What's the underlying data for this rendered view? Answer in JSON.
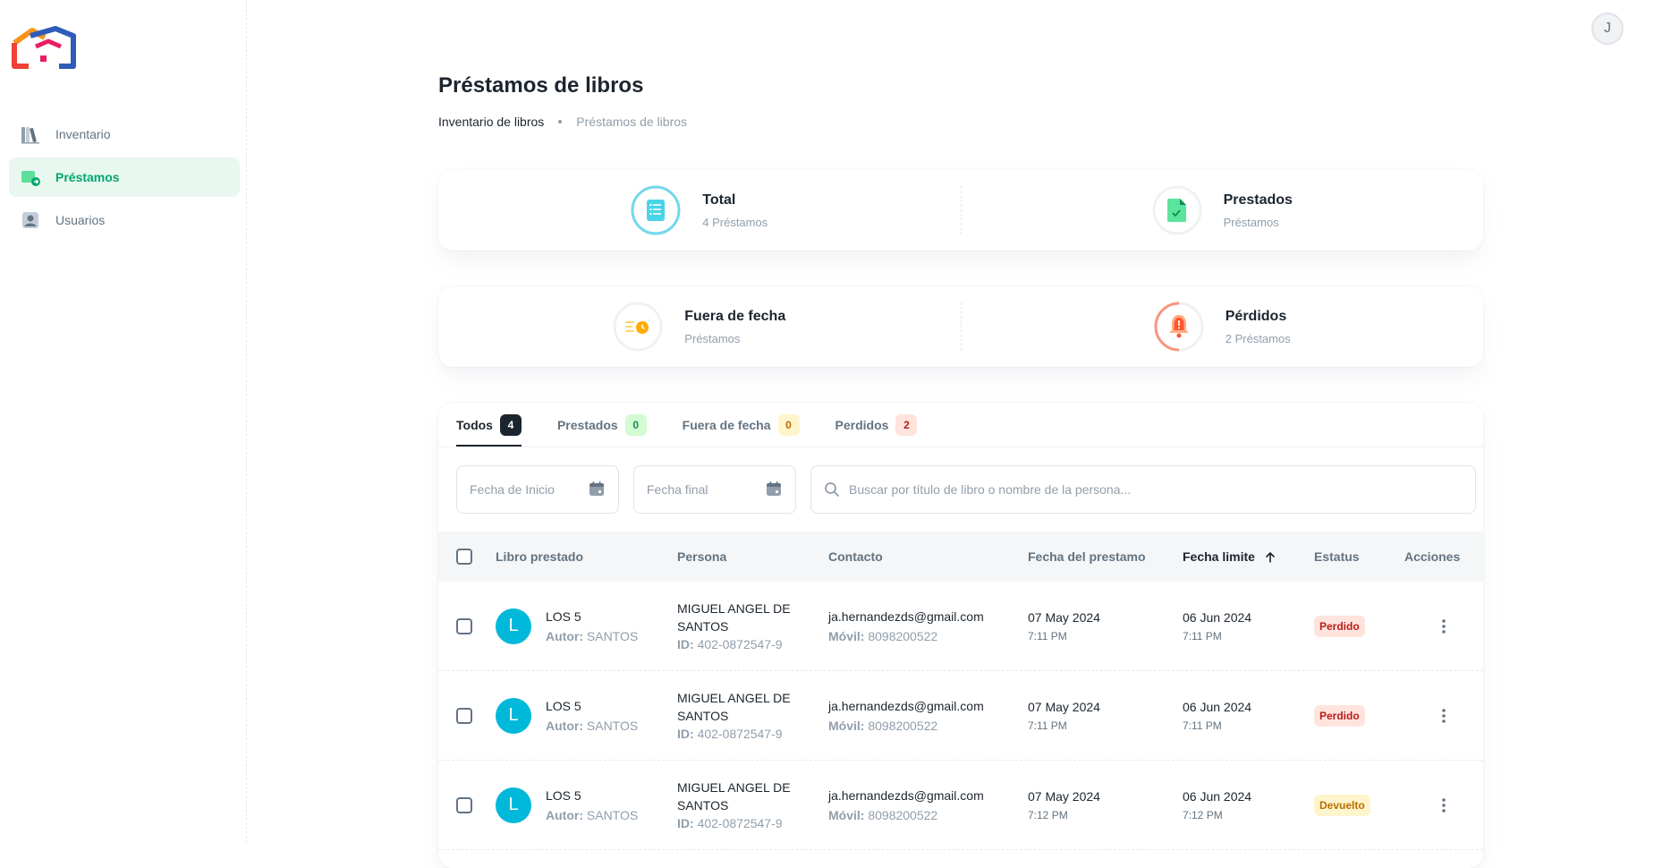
{
  "user": {
    "initial": "J"
  },
  "sidebar": {
    "items": [
      {
        "label": "Inventario",
        "icon": "books-icon"
      },
      {
        "label": "Préstamos",
        "icon": "loan-folder-icon"
      },
      {
        "label": "Usuarios",
        "icon": "user-icon"
      }
    ]
  },
  "header": {
    "title": "Préstamos de libros",
    "breadcrumb": [
      "Inventario de libros",
      "Préstamos de libros"
    ]
  },
  "stats": [
    {
      "title": "Total",
      "subtitle": "4 Préstamos",
      "icon": "list-icon",
      "color": "#00b8d9",
      "progress": 100
    },
    {
      "title": "Prestados",
      "subtitle": "Préstamos",
      "icon": "file-check-icon",
      "color": "#22c55e",
      "progress": 0
    },
    {
      "title": "Fuera de fecha",
      "subtitle": "Préstamos",
      "icon": "clock-list-icon",
      "color": "#ffab00",
      "progress": 0
    },
    {
      "title": "Pérdidos",
      "subtitle": "2 Préstamos",
      "icon": "bell-icon",
      "color": "#ff5630",
      "progress": 50
    }
  ],
  "tabs": [
    {
      "label": "Todos",
      "count": "4",
      "badge_bg": "#1c252e",
      "badge_fg": "#ffffff"
    },
    {
      "label": "Prestados",
      "count": "0",
      "badge_bg": "#d3fcd2",
      "badge_fg": "#118d57"
    },
    {
      "label": "Fuera de fecha",
      "count": "0",
      "badge_bg": "#fff5cc",
      "badge_fg": "#b76e00"
    },
    {
      "label": "Perdidos",
      "count": "2",
      "badge_bg": "#ffe9d5",
      "badge_fg": "#b71d18"
    }
  ],
  "filters": {
    "start_placeholder": "Fecha de Inicio",
    "end_placeholder": "Fecha final",
    "search_placeholder": "Buscar por título de libro o nombre de la persona..."
  },
  "table": {
    "columns": [
      "Libro prestado",
      "Persona",
      "Contacto",
      "Fecha del prestamo",
      "Fecha limite",
      "Estatus",
      "Acciones"
    ],
    "author_label": "Autor:",
    "id_label": "ID:",
    "phone_label": "Móvil:",
    "rows": [
      {
        "avatar": "L",
        "book": "LOS 5",
        "author": "SANTOS",
        "person_line1": "MIGUEL ANGEL DE",
        "person_line2": "SANTOS",
        "person_id": "402-0872547-9",
        "email": "ja.hernandezds@gmail.com",
        "phone": "8098200522",
        "loan_date": "07 May 2024",
        "loan_time": "7:11 PM",
        "due_date": "06 Jun 2024",
        "due_time": "7:11 PM",
        "status": "Perdido",
        "status_bg": "#ffe4de",
        "status_fg": "#b71d18"
      },
      {
        "avatar": "L",
        "book": "LOS 5",
        "author": "SANTOS",
        "person_line1": "MIGUEL ANGEL DE",
        "person_line2": "SANTOS",
        "person_id": "402-0872547-9",
        "email": "ja.hernandezds@gmail.com",
        "phone": "8098200522",
        "loan_date": "07 May 2024",
        "loan_time": "7:11 PM",
        "due_date": "06 Jun 2024",
        "due_time": "7:11 PM",
        "status": "Perdido",
        "status_bg": "#ffe4de",
        "status_fg": "#b71d18"
      },
      {
        "avatar": "L",
        "book": "LOS 5",
        "author": "SANTOS",
        "person_line1": "MIGUEL ANGEL DE",
        "person_line2": "SANTOS",
        "person_id": "402-0872547-9",
        "email": "ja.hernandezds@gmail.com",
        "phone": "8098200522",
        "loan_date": "07 May 2024",
        "loan_time": "7:12 PM",
        "due_date": "06 Jun 2024",
        "due_time": "7:12 PM",
        "status": "Devuelto",
        "status_bg": "#fff5cc",
        "status_fg": "#b76e00"
      }
    ]
  }
}
